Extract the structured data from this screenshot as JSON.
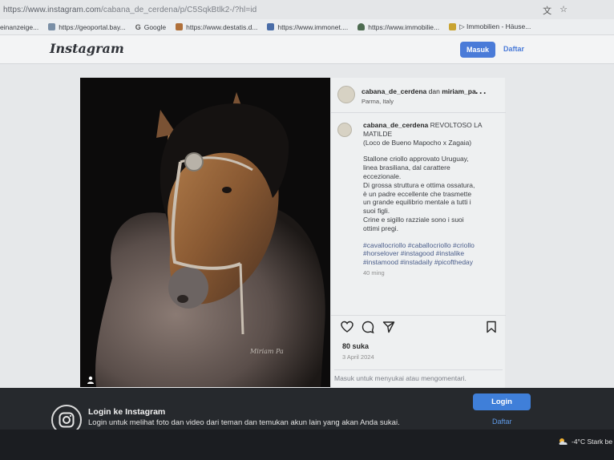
{
  "browser": {
    "url_host": "https://www.instagram.com",
    "url_path": "/cabana_de_cerdena/p/C5SqkBtlk2-/?hl=id",
    "bookmarks": [
      {
        "label": "einanzeige..."
      },
      {
        "label": "https://geoportal.bay..."
      },
      {
        "label": "Google"
      },
      {
        "label": "https://www.destatis.d..."
      },
      {
        "label": "https://www.immonet...."
      },
      {
        "label": "https://www.immobilie..."
      },
      {
        "label": "▷ Immobilien - Häuse..."
      }
    ]
  },
  "header": {
    "logo_text": "Instagram",
    "login_label": "Masuk",
    "signup_label": "Daftar"
  },
  "post": {
    "head_username": "cabana_de_cerdena",
    "head_connector": " dan ",
    "head_collab": "miriam_pa",
    "location": "Parma, Italy",
    "caption_username": "cabana_de_cerdena",
    "caption_lines_1": [
      "REVOLTOSO LA",
      "MATILDE",
      "(Loco de Bueno Mapocho x Zagaia)"
    ],
    "caption_lines_2": [
      "Stallone criollo approvato Uruguay,",
      "linea brasiliana, dal carattere",
      "eccezionale.",
      "Di grossa struttura e ottima ossatura,",
      "è un padre eccellente che trasmette",
      "un grande equilibrio mentale a tutti i",
      "suoi figli.",
      "Crine e sigillo razziale sono i suoi",
      "ottimi pregi."
    ],
    "hashtag_lines": [
      "#cavallocriollo #caballocriollo #criollo",
      "#horselover #instagood #instalike",
      "#instamood #instadaily #picoftheday"
    ],
    "time_ago": "40 ming",
    "likes": "80 suka",
    "date": "3 April 2024",
    "login_to_comment": "Masuk untuk menyukai atau mengomentari."
  },
  "login_bar": {
    "title": "Login ke Instagram",
    "description": "Login untuk melihat foto dan video dari teman dan temukan akun lain yang akan Anda sukai.",
    "login_button": "Login",
    "signup_link": "Daftar"
  },
  "taskbar": {
    "weather": "-4°C  Stark be"
  },
  "colors": {
    "accent": "#4a7bd8",
    "login_bar_bg": "#26292d"
  }
}
